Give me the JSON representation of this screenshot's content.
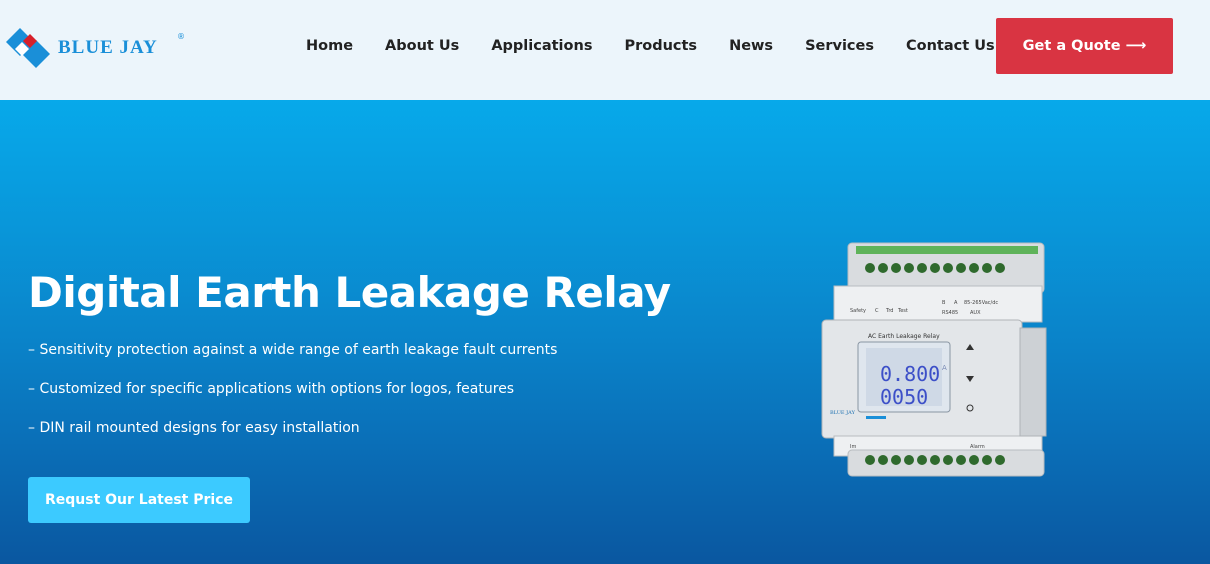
{
  "brand": {
    "name": "BLUE JAY",
    "reg_mark": "®"
  },
  "nav": {
    "items": [
      {
        "label": "Home"
      },
      {
        "label": "About Us"
      },
      {
        "label": "Applications"
      },
      {
        "label": "Products"
      },
      {
        "label": "News"
      },
      {
        "label": "Services"
      },
      {
        "label": "Contact Us"
      }
    ],
    "quote_label": "Get a Quote ⟶"
  },
  "hero": {
    "title": "Digital Earth Leakage Relay",
    "bullets": [
      "– Sensitivity protection against a wide range of earth leakage fault currents",
      "– Customized for specific applications with options for logos, features",
      "– DIN rail mounted designs for easy installation"
    ],
    "cta_label": "Requst Our Latest Price"
  },
  "device": {
    "label": "AC Earth Leakage Relay",
    "reading_top": "0.800",
    "reading_bottom": "0050",
    "unit": "A",
    "brand": "BLUE JAY",
    "top_labels": [
      "Safety",
      "C",
      "Trd",
      "Test",
      "B",
      "A",
      "85-265Vac/dc",
      "RS485",
      "AUX"
    ],
    "bottom_labels": [
      "Im",
      "Alarm"
    ]
  },
  "colors": {
    "header_bg": "#ecf5fb",
    "brand_blue": "#1a8fd8",
    "brand_red": "#d7202a",
    "quote_btn": "#d93442",
    "cta_btn": "#3ccaff",
    "hero_top": "#07a9ea",
    "hero_bottom": "#0a57a0"
  }
}
